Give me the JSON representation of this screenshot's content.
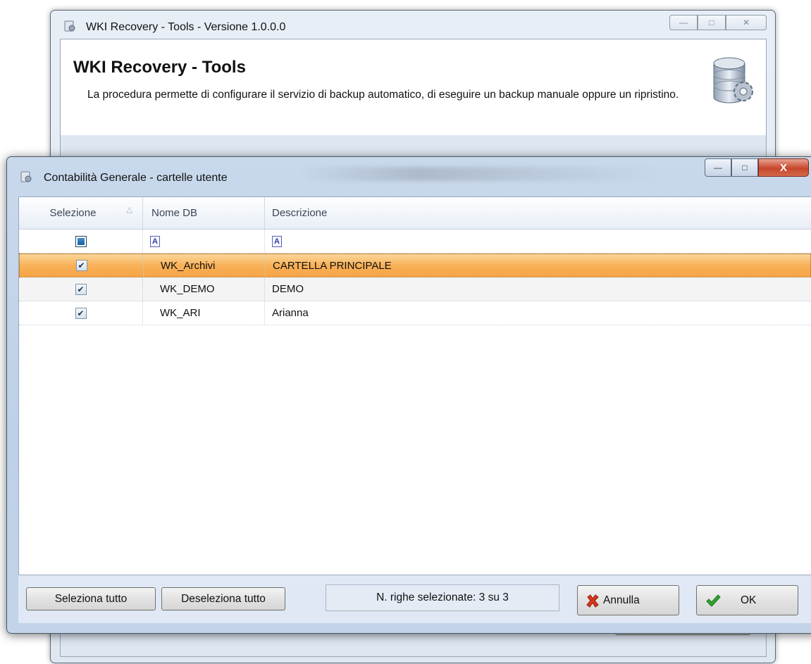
{
  "background_window": {
    "title": "WKI Recovery - Tools - Versione 1.0.0.0",
    "header_title": "WKI Recovery - Tools",
    "header_description": "La procedura permette di configurare il servizio di backup automatico, di eseguire un backup manuale oppure un ripristino.",
    "icon": "database-gear-icon"
  },
  "dialog": {
    "title": "Contabilità Generale - cartelle utente",
    "grid": {
      "columns": [
        "Selezione",
        "Nome DB",
        "Descrizione"
      ],
      "sorted_column": "Selezione",
      "rows": [
        {
          "selected": true,
          "db": "WK_Archivi",
          "description": "CARTELLA PRINCIPALE",
          "highlighted": true
        },
        {
          "selected": true,
          "db": "WK_DEMO",
          "description": "DEMO",
          "highlighted": false
        },
        {
          "selected": true,
          "db": "WK_ARI",
          "description": "Arianna",
          "highlighted": false
        }
      ]
    },
    "footer": {
      "select_all": "Seleziona tutto",
      "deselect_all": "Deseleziona tutto",
      "status": "N. righe selezionate: 3 su 3",
      "cancel": "Annulla",
      "ok": "OK"
    }
  },
  "colors": {
    "selection_highlight": "#f8b158",
    "dialog_frame": "#bcd0e7",
    "close_button": "#c7462a"
  }
}
